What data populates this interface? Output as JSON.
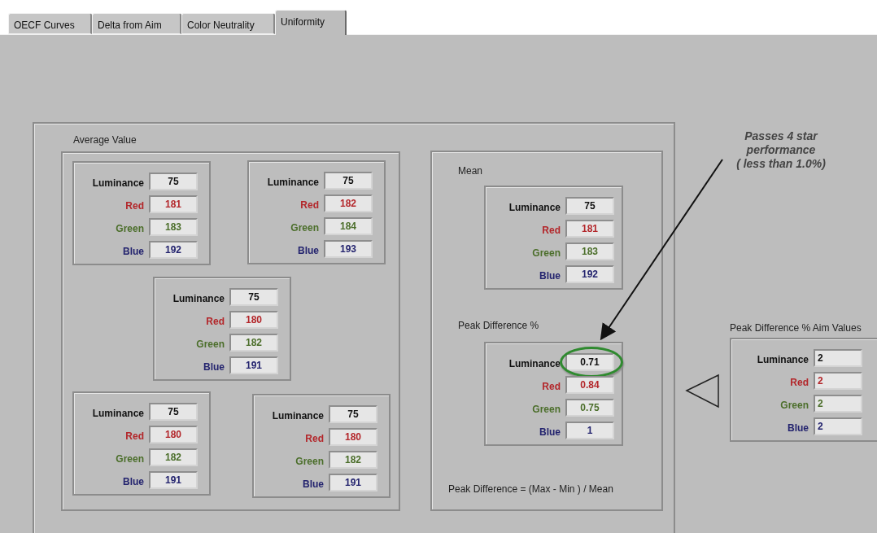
{
  "tabs": [
    {
      "label": "OECF Curves",
      "selected": false
    },
    {
      "label": "Delta from Aim",
      "selected": false
    },
    {
      "label": "Color Neutrality",
      "selected": false
    },
    {
      "label": "Uniformity",
      "selected": true
    }
  ],
  "average_value": {
    "label": "Average Value",
    "clusters": [
      {
        "rows": [
          {
            "label": "Luminance",
            "value": "75",
            "color": "#111111"
          },
          {
            "label": "Red",
            "value": "181",
            "color": "#b3262a"
          },
          {
            "label": "Green",
            "value": "183",
            "color": "#4b6e2a"
          },
          {
            "label": "Blue",
            "value": "192",
            "color": "#23236e"
          }
        ]
      },
      {
        "rows": [
          {
            "label": "Luminance",
            "value": "75",
            "color": "#111111"
          },
          {
            "label": "Red",
            "value": "182",
            "color": "#b3262a"
          },
          {
            "label": "Green",
            "value": "184",
            "color": "#4b6e2a"
          },
          {
            "label": "Blue",
            "value": "193",
            "color": "#23236e"
          }
        ]
      },
      {
        "rows": [
          {
            "label": "Luminance",
            "value": "75",
            "color": "#111111"
          },
          {
            "label": "Red",
            "value": "180",
            "color": "#b3262a"
          },
          {
            "label": "Green",
            "value": "182",
            "color": "#4b6e2a"
          },
          {
            "label": "Blue",
            "value": "191",
            "color": "#23236e"
          }
        ]
      },
      {
        "rows": [
          {
            "label": "Luminance",
            "value": "75",
            "color": "#111111"
          },
          {
            "label": "Red",
            "value": "180",
            "color": "#b3262a"
          },
          {
            "label": "Green",
            "value": "182",
            "color": "#4b6e2a"
          },
          {
            "label": "Blue",
            "value": "191",
            "color": "#23236e"
          }
        ]
      },
      {
        "rows": [
          {
            "label": "Luminance",
            "value": "75",
            "color": "#111111"
          },
          {
            "label": "Red",
            "value": "180",
            "color": "#b3262a"
          },
          {
            "label": "Green",
            "value": "182",
            "color": "#4b6e2a"
          },
          {
            "label": "Blue",
            "value": "191",
            "color": "#23236e"
          }
        ]
      }
    ]
  },
  "mean": {
    "label": "Mean",
    "rows": [
      {
        "label": "Luminance",
        "value": "75",
        "color": "#111111"
      },
      {
        "label": "Red",
        "value": "181",
        "color": "#b3262a"
      },
      {
        "label": "Green",
        "value": "183",
        "color": "#4b6e2a"
      },
      {
        "label": "Blue",
        "value": "192",
        "color": "#23236e"
      }
    ]
  },
  "peak_difference": {
    "label": "Peak Difference %",
    "rows": [
      {
        "label": "Luminance",
        "value": "0.71",
        "color": "#111111",
        "circled": true
      },
      {
        "label": "Red",
        "value": "0.84",
        "color": "#b3262a",
        "circled": false
      },
      {
        "label": "Green",
        "value": "0.75",
        "color": "#4b6e2a",
        "circled": false
      },
      {
        "label": "Blue",
        "value": "1",
        "color": "#23236e",
        "circled": false
      }
    ]
  },
  "formula": "Peak Difference = (Max - Min ) / Mean",
  "aim_values": {
    "label": "Peak Difference % Aim Values",
    "rows": [
      {
        "label": "Luminance",
        "value": "2",
        "color": "#111111"
      },
      {
        "label": "Red",
        "value": "2",
        "color": "#b3262a"
      },
      {
        "label": "Green",
        "value": "2",
        "color": "#4b6e2a"
      },
      {
        "label": "Blue",
        "value": "2",
        "color": "#23236e"
      }
    ]
  },
  "annotation": {
    "lines": [
      "Passes 4 star",
      "performance",
      "( less than 1.0%)"
    ]
  }
}
